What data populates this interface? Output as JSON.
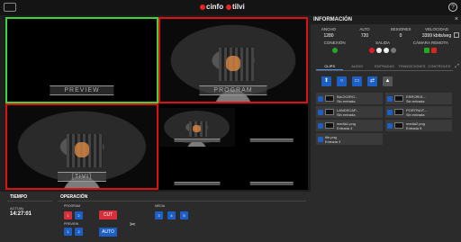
{
  "topbar": {
    "brand_one": "cinfo",
    "brand_two": "tilvi",
    "help_icon": "?"
  },
  "multiview": {
    "preview_label": "PREVIEW",
    "program_label": "PROGRAM",
    "input1_label": "[TiVI]"
  },
  "panel": {
    "title": "INFORMACIÓN",
    "close": "×",
    "expand": "⤢",
    "stats": [
      {
        "label": "ANCHO",
        "value": "1280"
      },
      {
        "label": "ALTO",
        "value": "720"
      },
      {
        "label": "SESIONES",
        "value": "0"
      },
      {
        "label": "VELOCIDAD",
        "value": "3399 kbits/seg"
      }
    ],
    "status": [
      {
        "label": "CONEXIÓN"
      },
      {
        "label": "SALIDA"
      },
      {
        "label": "CÁMARA REMOTA"
      }
    ],
    "tabs": [
      "CLIPS",
      "AUDIO",
      "ENTRADAS",
      "TRANSICIONES",
      "CONTROLES"
    ],
    "toolbar": [
      "⬆",
      "○",
      "▭",
      "⇄",
      "▲"
    ],
    "clips": [
      {
        "name": "BACKGRO...",
        "sub": "Sin entrada"
      },
      {
        "name": "ERROR01...",
        "sub": "Sin entrada"
      },
      {
        "name": "LANDSCAP...",
        "sub": "Sin entrada"
      },
      {
        "name": "PORTRAIT...",
        "sub": "Sin entrada"
      },
      {
        "name": "media1.png",
        "sub": "Entrada 4"
      },
      {
        "name": "media2.png",
        "sub": "Entrada 5"
      },
      {
        "name": "tile.png",
        "sub": "Entrada 3"
      }
    ]
  },
  "bottom": {
    "time_title": "TIEMPO",
    "op_title": "OPERACIÓN",
    "actual_label": "ACTUAL",
    "clock": "14:27:01",
    "program_label": "PROGRAM",
    "preview_label": "PREVIEW",
    "media_label": "MEDIA",
    "program_buttons": [
      "1",
      "2"
    ],
    "preview_buttons": [
      "1",
      "2"
    ],
    "media_buttons": [
      "3",
      "4",
      "5"
    ],
    "cut": "CUT",
    "auto": "AUTO",
    "cut_icon": "✂"
  }
}
